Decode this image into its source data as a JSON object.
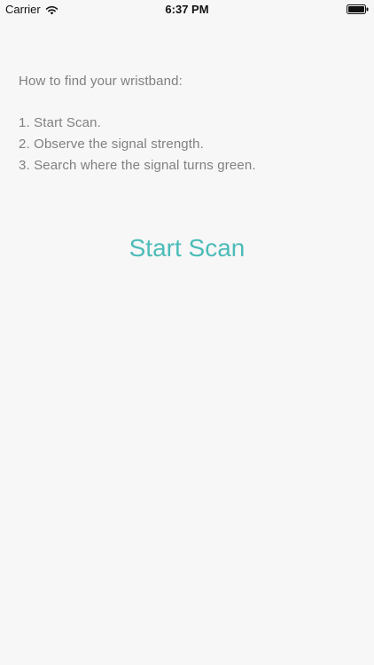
{
  "status_bar": {
    "carrier": "Carrier",
    "time": "6:37 PM"
  },
  "instructions": {
    "title": "How to find your wristband:",
    "steps": [
      "1. Start Scan.",
      "2. Observe the signal strength.",
      "3. Search where the signal turns green."
    ]
  },
  "actions": {
    "start_scan_label": "Start Scan"
  },
  "colors": {
    "accent": "#4cbcb9",
    "instruction_text": "#808080",
    "background": "#f7f7f7"
  }
}
